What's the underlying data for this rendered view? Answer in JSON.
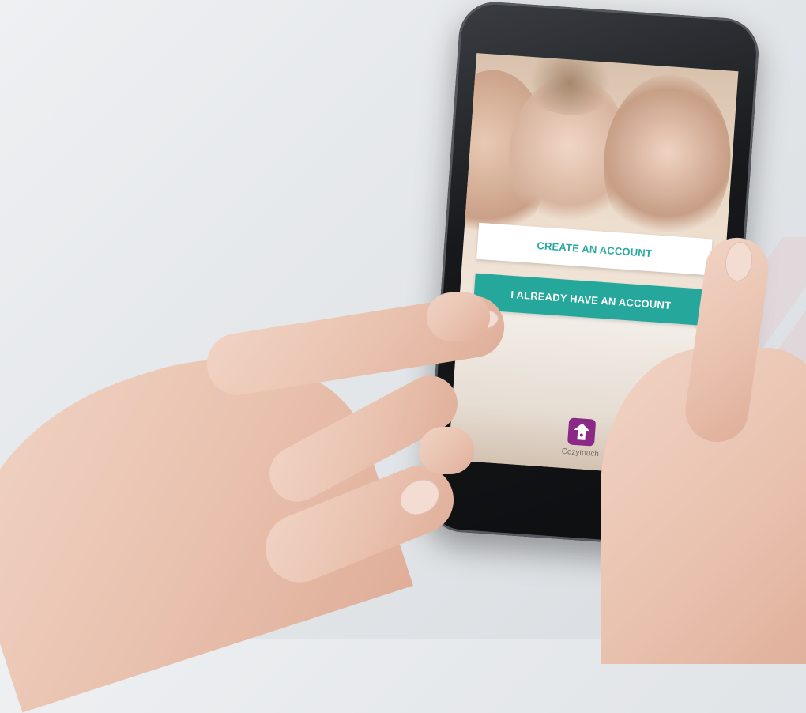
{
  "background": {
    "color": "#e4e7ea"
  },
  "phone": {
    "screen": {
      "create_account_label": "CREATE AN ACCOUNT",
      "login_label": "I ALREADY HAVE AN ACCOUNT",
      "logo_text": "Cozytouch"
    }
  },
  "colors": {
    "accent": "#26a79c",
    "brand": "#8b2a86",
    "button_light": "#ffffff"
  }
}
